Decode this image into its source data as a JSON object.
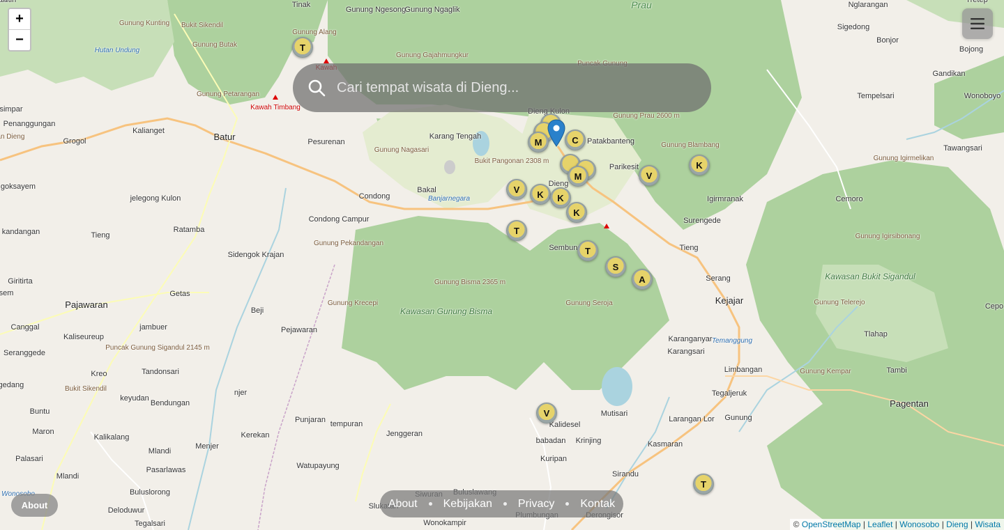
{
  "search": {
    "placeholder": "Cari tempat wisata di Dieng..."
  },
  "zoom": {
    "in": "+",
    "out": "−"
  },
  "about_button": "About",
  "footer_nav": [
    "About",
    "Kebijakan",
    "Privacy",
    "Kontak"
  ],
  "attribution": {
    "prefix": "©",
    "links": [
      "OpenStreetMap",
      "Leaflet",
      "Wonosobo",
      "Dieng",
      "Wisata"
    ]
  },
  "map_labels": [
    {
      "t": "Tinak",
      "c": ""
    },
    {
      "t": "Gunung Ngesong",
      "c": ""
    },
    {
      "t": "Gunung Ngaglik",
      "c": ""
    },
    {
      "t": "Prau",
      "c": "prau"
    },
    {
      "t": "Nglarangan",
      "c": ""
    },
    {
      "t": "Tretep",
      "c": ""
    },
    {
      "t": "Gunung Kunting",
      "c": "peak"
    },
    {
      "t": "Bukit Sikendil",
      "c": "peak"
    },
    {
      "t": "Gunung Alang",
      "c": "peak"
    },
    {
      "t": "Sigedong",
      "c": ""
    },
    {
      "t": "Bonjor",
      "c": ""
    },
    {
      "t": "Bojong",
      "c": ""
    },
    {
      "t": "Hutan Undung",
      "c": "blue"
    },
    {
      "t": "Gunung Butak",
      "c": "peak"
    },
    {
      "t": "Gunung Gajahmungkur",
      "c": "peak"
    },
    {
      "t": "Puncak Gunung",
      "c": "peak"
    },
    {
      "t": "Kawah",
      "c": "red"
    },
    {
      "t": "Gandikan",
      "c": ""
    },
    {
      "t": "Gunung Petarangan",
      "c": "peak"
    },
    {
      "t": "Kawah Timbang",
      "c": "red"
    },
    {
      "t": "Tempelsari",
      "c": ""
    },
    {
      "t": "Wonoboyo",
      "c": ""
    },
    {
      "t": "simpar",
      "c": ""
    },
    {
      "t": "Dieng Kulon",
      "c": ""
    },
    {
      "t": "Penanggungan",
      "c": ""
    },
    {
      "t": "Gunung Prau 2600 m",
      "c": "peak"
    },
    {
      "t": "Kalianget",
      "c": ""
    },
    {
      "t": "Grogol",
      "c": ""
    },
    {
      "t": "Batur",
      "c": "big"
    },
    {
      "t": "Pesurenan",
      "c": ""
    },
    {
      "t": "Karang Tengah",
      "c": ""
    },
    {
      "t": "Patakbanteng",
      "c": ""
    },
    {
      "t": "Gunung Nagasari",
      "c": "peak"
    },
    {
      "t": "Gunung Blambang",
      "c": "peak"
    },
    {
      "t": "Tawangsari",
      "c": ""
    },
    {
      "t": "Bukit Pangonan 2308 m",
      "c": "peak"
    },
    {
      "t": "Parikesit",
      "c": ""
    },
    {
      "t": "Gunung Igirmelikan",
      "c": "peak"
    },
    {
      "t": "goksayem",
      "c": ""
    },
    {
      "t": "Dieng",
      "c": ""
    },
    {
      "t": "Bakal",
      "c": ""
    },
    {
      "t": "Igirmranak",
      "c": ""
    },
    {
      "t": "Cemoro",
      "c": ""
    },
    {
      "t": "jelegong Kulon",
      "c": ""
    },
    {
      "t": "Condong",
      "c": ""
    },
    {
      "t": "Banjarnegara",
      "c": "blue"
    },
    {
      "t": "Ratamba",
      "c": ""
    },
    {
      "t": "Condong Campur",
      "c": ""
    },
    {
      "t": "Surengede",
      "c": ""
    },
    {
      "t": "kandangan",
      "c": ""
    },
    {
      "t": "Tieng",
      "c": ""
    },
    {
      "t": "Gunung Pekandangan",
      "c": "peak"
    },
    {
      "t": "Sembungan",
      "c": ""
    },
    {
      "t": "Tieng",
      "c": ""
    },
    {
      "t": "Gunung Igirsibonang",
      "c": "peak"
    },
    {
      "t": "Sidengok Krajan",
      "c": ""
    },
    {
      "t": "Kawasan Bukit Sigandul",
      "c": "green"
    },
    {
      "t": "Giritirta",
      "c": ""
    },
    {
      "t": "Gunung Bisma 2365 m",
      "c": "peak"
    },
    {
      "t": "Serang",
      "c": ""
    },
    {
      "t": "Getas",
      "c": ""
    },
    {
      "t": "sem",
      "c": ""
    },
    {
      "t": "Kawasan Gunung Bisma",
      "c": "green"
    },
    {
      "t": "Gunung Krecepi",
      "c": "peak"
    },
    {
      "t": "Gunung Seroja",
      "c": "peak"
    },
    {
      "t": "Kejajar",
      "c": "big"
    },
    {
      "t": "Cepo",
      "c": ""
    },
    {
      "t": "Pajawaran",
      "c": "big"
    },
    {
      "t": "Beji",
      "c": ""
    },
    {
      "t": "Gunung Telerejo",
      "c": "peak"
    },
    {
      "t": "Canggal",
      "c": ""
    },
    {
      "t": "jambuer",
      "c": ""
    },
    {
      "t": "Pejawaran",
      "c": ""
    },
    {
      "t": "Kaliseureup",
      "c": ""
    },
    {
      "t": "Tlahap",
      "c": ""
    },
    {
      "t": "Puncak Gunung Sigandul 2145 m",
      "c": "peak"
    },
    {
      "t": "Karanganyar",
      "c": ""
    },
    {
      "t": "Seranggede",
      "c": ""
    },
    {
      "t": "Karangsari",
      "c": ""
    },
    {
      "t": "Kreo",
      "c": ""
    },
    {
      "t": "Tandonsari",
      "c": ""
    },
    {
      "t": "Limbangan",
      "c": ""
    },
    {
      "t": "Tambi",
      "c": ""
    },
    {
      "t": "Gunung Kempar",
      "c": "peak"
    },
    {
      "t": "Sigedang",
      "c": ""
    },
    {
      "t": "Bukit Sikendil",
      "c": "peak"
    },
    {
      "t": "njer",
      "c": ""
    },
    {
      "t": "keyudan",
      "c": ""
    },
    {
      "t": "Tegaljeruk",
      "c": ""
    },
    {
      "t": "Bendungan",
      "c": ""
    },
    {
      "t": "Buntu",
      "c": ""
    },
    {
      "t": "Punjaran",
      "c": ""
    },
    {
      "t": "tempuran",
      "c": ""
    },
    {
      "t": "Kalidesel",
      "c": ""
    },
    {
      "t": "Mutisari",
      "c": ""
    },
    {
      "t": "Larangan Lor",
      "c": ""
    },
    {
      "t": "Maron",
      "c": ""
    },
    {
      "t": "Kalikalang",
      "c": ""
    },
    {
      "t": "Kerekan",
      "c": ""
    },
    {
      "t": "Jenggeran",
      "c": ""
    },
    {
      "t": "babadan",
      "c": ""
    },
    {
      "t": "Krinjing",
      "c": ""
    },
    {
      "t": "Mlandi",
      "c": ""
    },
    {
      "t": "Menjer",
      "c": ""
    },
    {
      "t": "Kasmaran",
      "c": ""
    },
    {
      "t": "Palasari",
      "c": ""
    },
    {
      "t": "Kuripan",
      "c": ""
    },
    {
      "t": "Watupayung",
      "c": ""
    },
    {
      "t": "Mlandi",
      "c": ""
    },
    {
      "t": "Pasarlawas",
      "c": ""
    },
    {
      "t": "Sirandu",
      "c": ""
    },
    {
      "t": "Buluslorong",
      "c": ""
    },
    {
      "t": "Siwuran",
      "c": ""
    },
    {
      "t": "Buluslawang",
      "c": ""
    },
    {
      "t": "Deloduwur",
      "c": ""
    },
    {
      "t": "Slukatan",
      "c": ""
    },
    {
      "t": "Plumbungan",
      "c": ""
    },
    {
      "t": "Wonokampir",
      "c": ""
    },
    {
      "t": "Tegalsari",
      "c": ""
    },
    {
      "t": "Derongisor",
      "c": ""
    },
    {
      "t": "Pagentan",
      "c": "big"
    },
    {
      "t": "Gunung",
      "c": ""
    },
    {
      "t": "Temanggung",
      "c": "blue"
    },
    {
      "t": "Wonosobo",
      "c": "blue"
    },
    {
      "t": "Jalan Dieng",
      "c": "peak"
    },
    {
      "t": "ung Putih",
      "c": ""
    },
    {
      "t": "wan",
      "c": ""
    }
  ],
  "markers": [
    "T",
    "M",
    "C",
    "V",
    "K",
    "K",
    "K",
    "K",
    "M",
    "T",
    "V",
    "T",
    "S",
    "A",
    "V",
    "T"
  ]
}
